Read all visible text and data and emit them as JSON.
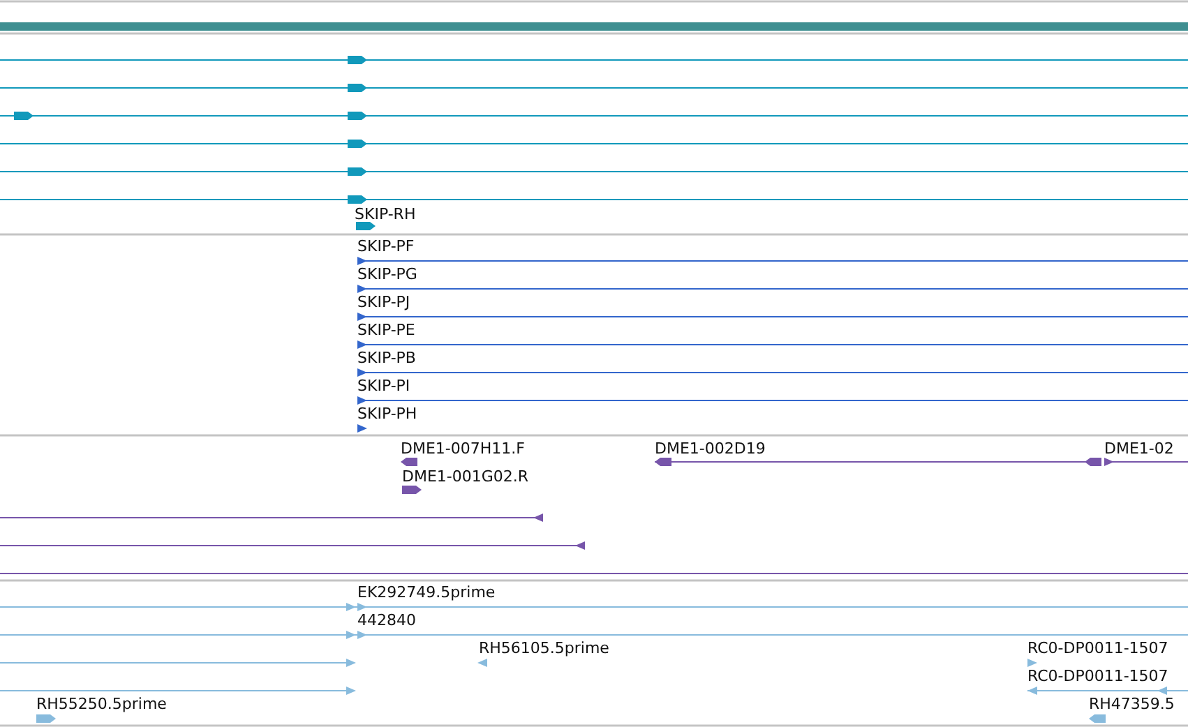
{
  "tracks": [
    {
      "color": "#1199bb",
      "features": [
        {
          "kind": "forward"
        },
        {
          "kind": "forward"
        },
        {
          "kind": "forward"
        },
        {
          "kind": "forward"
        },
        {
          "kind": "forward"
        },
        {
          "kind": "forward"
        },
        {
          "label": "SKIP-RH",
          "kind": "forward"
        }
      ]
    },
    {
      "color": "#3366cc",
      "features": [
        {
          "label": "SKIP-PF",
          "kind": "forward"
        },
        {
          "label": "SKIP-PG",
          "kind": "forward"
        },
        {
          "label": "SKIP-PJ",
          "kind": "forward"
        },
        {
          "label": "SKIP-PE",
          "kind": "forward"
        },
        {
          "label": "SKIP-PB",
          "kind": "forward"
        },
        {
          "label": "SKIP-PI",
          "kind": "forward"
        },
        {
          "label": "SKIP-PH",
          "kind": "forward"
        }
      ]
    },
    {
      "color": "#7755aa",
      "features": [
        {
          "label": "DME1-007H11.F",
          "kind": "reverse"
        },
        {
          "label": "DME1-002D19",
          "kind": "reverse"
        },
        {
          "label": "DME1-02",
          "kind": "forward"
        },
        {
          "label": "DME1-001G02.R",
          "kind": "forward"
        },
        {
          "kind": "reverse"
        },
        {
          "kind": "reverse"
        },
        {
          "kind": "line"
        }
      ]
    },
    {
      "color": "#88bbdd",
      "features": [
        {
          "label": "EK292749.5prime",
          "kind": "forward"
        },
        {
          "label": "442840",
          "kind": "forward"
        },
        {
          "label": "RH56105.5prime",
          "kind": "reverse"
        },
        {
          "kind": "forward"
        },
        {
          "kind": "forward"
        },
        {
          "label": "RC0-DP0011-1507",
          "kind": "forward"
        },
        {
          "label": "RC0-DP0011-1507",
          "kind": "reverse"
        },
        {
          "label": "RH55250.5prime",
          "kind": "forward"
        },
        {
          "label": "RH47359.5",
          "kind": "reverse"
        }
      ]
    }
  ]
}
